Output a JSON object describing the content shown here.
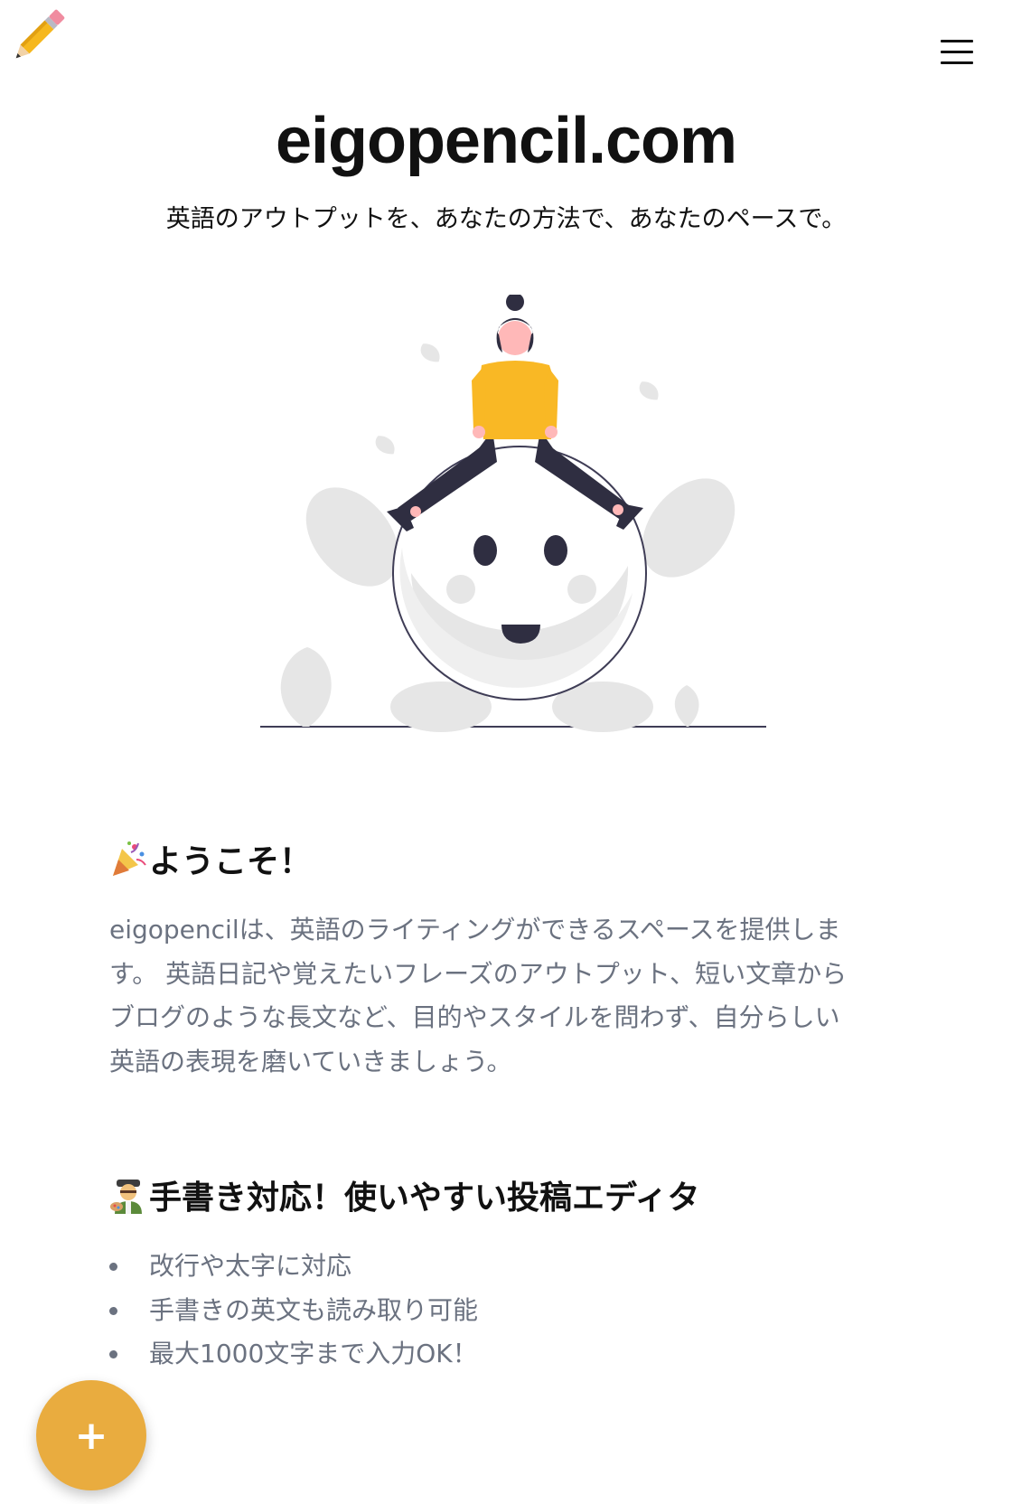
{
  "header": {
    "logo_icon": "pencil-icon",
    "menu_icon": "hamburger-menu-icon"
  },
  "hero": {
    "title": "eigopencil.com",
    "subtitle": "英語のアウトプットを、あなたの方法で、あなたのペースで。"
  },
  "welcome": {
    "icon": "party-popper-icon",
    "heading": "ようこそ！",
    "lines": [
      "eigopencilは、英語のライティングができるスペースを提供しま",
      "す。 英語日記や覚えたいフレーズのアウトプット、短い文章から",
      "ブログのような長文など、目的やスタイルを問わず、自分らしい",
      "英語の表現を磨いていきましょう。"
    ]
  },
  "editor": {
    "icon": "artist-icon",
    "heading": "手書き対応！使いやすい投稿エディタ",
    "features": [
      "改行や太字に対応",
      "手書きの英文も読み取り可能",
      "最大1000文字まで入力OK！"
    ]
  },
  "fab": {
    "label": "+",
    "icon": "plus-icon"
  },
  "colors": {
    "accent": "#e9ac3f",
    "text": "#111111",
    "muted": "#6b7280",
    "illustration_shirt": "#f9b825",
    "illustration_dark": "#2f2e41",
    "illustration_gray": "#e6e6e6"
  }
}
